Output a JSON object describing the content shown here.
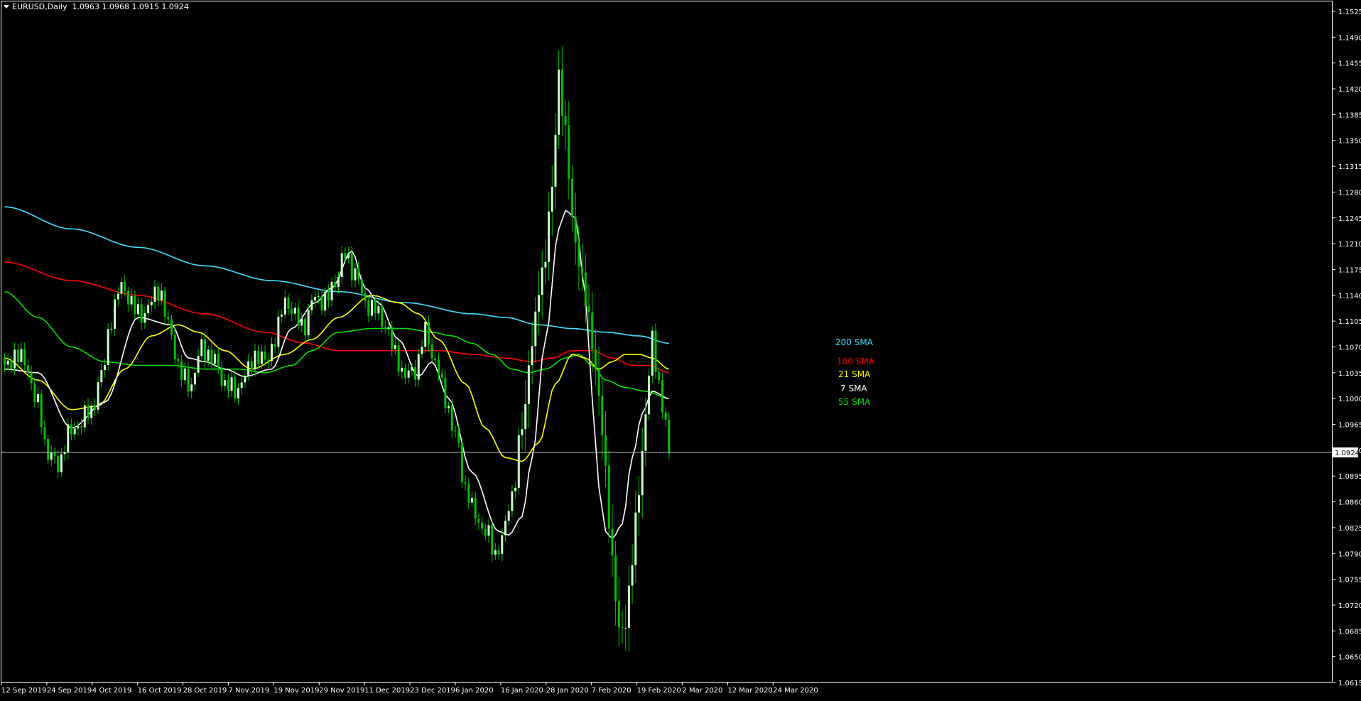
{
  "header": {
    "symbol": "EURUSD,Daily",
    "ohlc": "1.0963 1.0968 1.0915 1.0924"
  },
  "colors": {
    "background": "#000000",
    "bull": "#c8ffc8",
    "bear": "#00c000",
    "axis": "#ffffff",
    "sma200": "#40e0ff",
    "sma100": "#ff0000",
    "sma21": "#ffff00",
    "sma7": "#ffffff",
    "sma55": "#00e000"
  },
  "chart_data": {
    "type": "candlestick",
    "title": "",
    "ylim": [
      1.0615,
      1.1525
    ],
    "y_ticks": [
      "1.1525",
      "1.1490",
      "1.1455",
      "1.1420",
      "1.1385",
      "1.1350",
      "1.1315",
      "1.1280",
      "1.1245",
      "1.1210",
      "1.1175",
      "1.1140",
      "1.1105",
      "1.1070",
      "1.1035",
      "1.1000",
      "1.0965",
      "1.0930",
      "1.0895",
      "1.0860",
      "1.0825",
      "1.0790",
      "1.0755",
      "1.0720",
      "1.0685",
      "1.0650",
      "1.0615"
    ],
    "x_ticks": [
      "12 Sep 2019",
      "24 Sep 2019",
      "4 Oct 2019",
      "16 Oct 2019",
      "28 Oct 2019",
      "7 Nov 2019",
      "19 Nov 2019",
      "29 Nov 2019",
      "11 Dec 2019",
      "23 Dec 2019",
      "6 Jan 2020",
      "16 Jan 2020",
      "28 Jan 2020",
      "7 Feb 2020",
      "19 Feb 2020",
      "2 Mar 2020",
      "12 Mar 2020",
      "24 Mar 2020"
    ],
    "current_price": "1.0924",
    "legend": [
      {
        "name": "200 SMA",
        "color": "#40e0ff"
      },
      {
        "name": "100 SMA",
        "color": "#ff0000"
      },
      {
        "name": "21 SMA",
        "color": "#ffff00"
      },
      {
        "name": "7 SMA",
        "color": "#ffffff"
      },
      {
        "name": "55 SMA",
        "color": "#00e000"
      }
    ],
    "close_anchors": [
      {
        "i": 0,
        "v": 1.104
      },
      {
        "i": 3,
        "v": 1.106
      },
      {
        "i": 6,
        "v": 1.105
      },
      {
        "i": 10,
        "v": 1.099
      },
      {
        "i": 13,
        "v": 1.0925
      },
      {
        "i": 16,
        "v": 1.091
      },
      {
        "i": 19,
        "v": 1.095
      },
      {
        "i": 22,
        "v": 1.0965
      },
      {
        "i": 26,
        "v": 1.0985
      },
      {
        "i": 29,
        "v": 1.103
      },
      {
        "i": 32,
        "v": 1.111
      },
      {
        "i": 35,
        "v": 1.1155
      },
      {
        "i": 39,
        "v": 1.112
      },
      {
        "i": 42,
        "v": 1.1115
      },
      {
        "i": 46,
        "v": 1.115
      },
      {
        "i": 49,
        "v": 1.11
      },
      {
        "i": 53,
        "v": 1.103
      },
      {
        "i": 56,
        "v": 1.102
      },
      {
        "i": 59,
        "v": 1.107
      },
      {
        "i": 63,
        "v": 1.105
      },
      {
        "i": 66,
        "v": 1.102
      },
      {
        "i": 69,
        "v": 1.101
      },
      {
        "i": 72,
        "v": 1.103
      },
      {
        "i": 75,
        "v": 1.106
      },
      {
        "i": 78,
        "v": 1.105
      },
      {
        "i": 81,
        "v": 1.108
      },
      {
        "i": 84,
        "v": 1.1135
      },
      {
        "i": 87,
        "v": 1.111
      },
      {
        "i": 90,
        "v": 1.11
      },
      {
        "i": 93,
        "v": 1.114
      },
      {
        "i": 96,
        "v": 1.113
      },
      {
        "i": 99,
        "v": 1.116
      },
      {
        "i": 102,
        "v": 1.1195
      },
      {
        "i": 105,
        "v": 1.117
      },
      {
        "i": 108,
        "v": 1.113
      },
      {
        "i": 111,
        "v": 1.112
      },
      {
        "i": 114,
        "v": 1.11
      },
      {
        "i": 117,
        "v": 1.106
      },
      {
        "i": 120,
        "v": 1.103
      },
      {
        "i": 123,
        "v": 1.104
      },
      {
        "i": 126,
        "v": 1.109
      },
      {
        "i": 129,
        "v": 1.105
      },
      {
        "i": 132,
        "v": 1.1
      },
      {
        "i": 135,
        "v": 1.095
      },
      {
        "i": 138,
        "v": 1.088
      },
      {
        "i": 141,
        "v": 1.084
      },
      {
        "i": 144,
        "v": 1.082
      },
      {
        "i": 147,
        "v": 1.079
      },
      {
        "i": 149,
        "v": 1.081
      },
      {
        "i": 152,
        "v": 1.087
      },
      {
        "i": 155,
        "v": 1.096
      },
      {
        "i": 158,
        "v": 1.108
      },
      {
        "i": 161,
        "v": 1.117
      },
      {
        "i": 164,
        "v": 1.128
      },
      {
        "i": 166,
        "v": 1.144
      },
      {
        "i": 168,
        "v": 1.136
      },
      {
        "i": 170,
        "v": 1.124
      },
      {
        "i": 172,
        "v": 1.119
      },
      {
        "i": 174,
        "v": 1.113
      },
      {
        "i": 176,
        "v": 1.108
      },
      {
        "i": 178,
        "v": 1.1
      },
      {
        "i": 180,
        "v": 1.09
      },
      {
        "i": 182,
        "v": 1.078
      },
      {
        "i": 184,
        "v": 1.068
      },
      {
        "i": 186,
        "v": 1.07
      },
      {
        "i": 188,
        "v": 1.078
      },
      {
        "i": 190,
        "v": 1.088
      },
      {
        "i": 192,
        "v": 1.098
      },
      {
        "i": 194,
        "v": 1.108
      },
      {
        "i": 196,
        "v": 1.102
      },
      {
        "i": 198,
        "v": 1.096
      },
      {
        "i": 199,
        "v": 1.0924
      }
    ],
    "sma7": [
      [
        0,
        1.104
      ],
      [
        10,
        1.1035
      ],
      [
        20,
        1.096
      ],
      [
        30,
        1.0995
      ],
      [
        40,
        1.111
      ],
      [
        50,
        1.11
      ],
      [
        55,
        1.1055
      ],
      [
        60,
        1.105
      ],
      [
        66,
        1.104
      ],
      [
        72,
        1.103
      ],
      [
        80,
        1.104
      ],
      [
        86,
        1.1095
      ],
      [
        93,
        1.113
      ],
      [
        98,
        1.115
      ],
      [
        104,
        1.12
      ],
      [
        108,
        1.115
      ],
      [
        112,
        1.113
      ],
      [
        118,
        1.108
      ],
      [
        124,
        1.103
      ],
      [
        128,
        1.105
      ],
      [
        133,
        1.1
      ],
      [
        140,
        1.09
      ],
      [
        148,
        1.082
      ],
      [
        151,
        1.0815
      ],
      [
        155,
        1.084
      ],
      [
        158,
        1.092
      ],
      [
        162,
        1.108
      ],
      [
        166,
        1.123
      ],
      [
        168,
        1.1255
      ],
      [
        171,
        1.1245
      ],
      [
        174,
        1.114
      ],
      [
        176,
        1.1
      ],
      [
        178,
        1.088
      ],
      [
        180,
        1.082
      ],
      [
        182,
        1.081
      ],
      [
        185,
        1.083
      ],
      [
        188,
        1.092
      ],
      [
        191,
        1.098
      ],
      [
        194,
        1.101
      ],
      [
        199,
        1.1
      ]
    ],
    "sma21": [
      [
        0,
        1.1055
      ],
      [
        10,
        1.1025
      ],
      [
        20,
        1.0985
      ],
      [
        28,
        1.099
      ],
      [
        36,
        1.104
      ],
      [
        44,
        1.1085
      ],
      [
        52,
        1.11
      ],
      [
        58,
        1.109
      ],
      [
        66,
        1.1065
      ],
      [
        74,
        1.104
      ],
      [
        84,
        1.106
      ],
      [
        92,
        1.108
      ],
      [
        100,
        1.111
      ],
      [
        110,
        1.114
      ],
      [
        118,
        1.113
      ],
      [
        124,
        1.1115
      ],
      [
        130,
        1.108
      ],
      [
        138,
        1.102
      ],
      [
        144,
        1.096
      ],
      [
        150,
        1.092
      ],
      [
        155,
        1.0915
      ],
      [
        160,
        1.094
      ],
      [
        165,
        1.102
      ],
      [
        170,
        1.106
      ],
      [
        174,
        1.1055
      ],
      [
        178,
        1.104
      ],
      [
        182,
        1.105
      ],
      [
        186,
        1.106
      ],
      [
        190,
        1.106
      ],
      [
        194,
        1.1055
      ],
      [
        199,
        1.104
      ]
    ],
    "sma55": [
      [
        0,
        1.1145
      ],
      [
        10,
        1.111
      ],
      [
        20,
        1.107
      ],
      [
        30,
        1.105
      ],
      [
        40,
        1.1045
      ],
      [
        50,
        1.1045
      ],
      [
        60,
        1.104
      ],
      [
        70,
        1.104
      ],
      [
        78,
        1.1035
      ],
      [
        86,
        1.1045
      ],
      [
        92,
        1.1065
      ],
      [
        100,
        1.109
      ],
      [
        110,
        1.1095
      ],
      [
        120,
        1.1095
      ],
      [
        128,
        1.109
      ],
      [
        134,
        1.1085
      ],
      [
        140,
        1.1075
      ],
      [
        146,
        1.106
      ],
      [
        152,
        1.104
      ],
      [
        157,
        1.1035
      ],
      [
        162,
        1.104
      ],
      [
        168,
        1.1055
      ],
      [
        172,
        1.106
      ],
      [
        176,
        1.1045
      ],
      [
        180,
        1.1025
      ],
      [
        186,
        1.1015
      ],
      [
        192,
        1.101
      ],
      [
        199,
        1.1
      ]
    ],
    "sma100": [
      [
        0,
        1.1185
      ],
      [
        20,
        1.116
      ],
      [
        40,
        1.114
      ],
      [
        60,
        1.1115
      ],
      [
        78,
        1.109
      ],
      [
        90,
        1.1075
      ],
      [
        100,
        1.1065
      ],
      [
        110,
        1.1065
      ],
      [
        120,
        1.1065
      ],
      [
        130,
        1.1065
      ],
      [
        140,
        1.106
      ],
      [
        150,
        1.1055
      ],
      [
        158,
        1.105
      ],
      [
        164,
        1.1055
      ],
      [
        170,
        1.1065
      ],
      [
        176,
        1.1065
      ],
      [
        182,
        1.1055
      ],
      [
        188,
        1.1045
      ],
      [
        193,
        1.1045
      ],
      [
        199,
        1.1035
      ]
    ],
    "sma200": [
      [
        0,
        1.126
      ],
      [
        20,
        1.123
      ],
      [
        40,
        1.1205
      ],
      [
        60,
        1.118
      ],
      [
        80,
        1.116
      ],
      [
        100,
        1.1145
      ],
      [
        120,
        1.113
      ],
      [
        140,
        1.1115
      ],
      [
        150,
        1.111
      ],
      [
        160,
        1.11
      ],
      [
        170,
        1.1095
      ],
      [
        180,
        1.109
      ],
      [
        190,
        1.1085
      ],
      [
        199,
        1.1075
      ]
    ]
  }
}
